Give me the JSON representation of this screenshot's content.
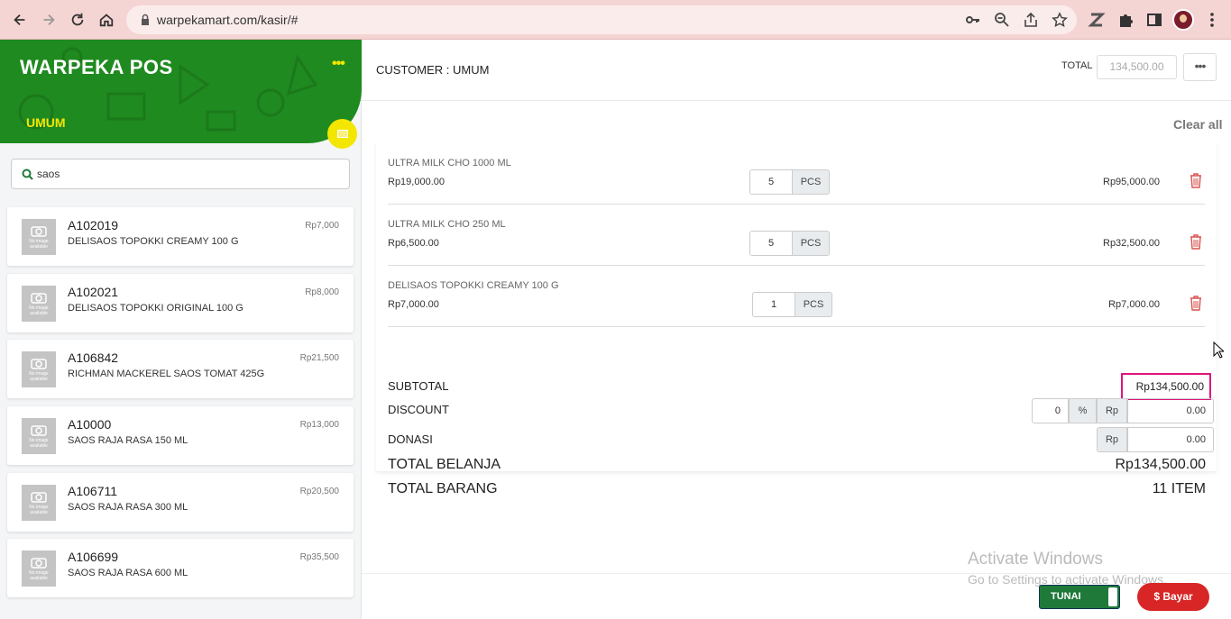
{
  "browser": {
    "url": "warpekamart.com/kasir/#"
  },
  "app": {
    "title": "WARPEKA POS",
    "menu_dots": "•••",
    "customer_tag": "UMUM"
  },
  "search": {
    "value": "saos"
  },
  "products": [
    {
      "code": "A102019",
      "name": "DELISAOS TOPOKKI CREAMY 100 G",
      "price": "Rp7,000"
    },
    {
      "code": "A102021",
      "name": "DELISAOS TOPOKKI ORIGINAL 100 G",
      "price": "Rp8,000"
    },
    {
      "code": "A106842",
      "name": "RICHMAN MACKEREL SAOS TOMAT 425G",
      "price": "Rp21,500"
    },
    {
      "code": "A10000",
      "name": "SAOS RAJA RASA 150 ML",
      "price": "Rp13,000"
    },
    {
      "code": "A106711",
      "name": "SAOS RAJA RASA 300 ML",
      "price": "Rp20,500"
    },
    {
      "code": "A106699",
      "name": "SAOS RAJA RASA 600 ML",
      "price": "Rp35,500"
    }
  ],
  "no_image_text": "No image available",
  "header": {
    "customer": "CUSTOMER : UMUM",
    "total_label": "TOTAL",
    "total_value": "134,500.00",
    "more": "•••"
  },
  "cart": {
    "clear_all": "Clear all",
    "items": [
      {
        "name": "ULTRA MILK CHO 1000 ML",
        "price": "Rp19,000.00",
        "qty": "5",
        "unit": "PCS",
        "total": "Rp95,000.00"
      },
      {
        "name": "ULTRA MILK CHO 250 ML",
        "price": "Rp6,500.00",
        "qty": "5",
        "unit": "PCS",
        "total": "Rp32,500.00"
      },
      {
        "name": "DELISAOS TOPOKKI CREAMY 100 G",
        "price": "Rp7,000.00",
        "qty": "1",
        "unit": "PCS",
        "total": "Rp7,000.00"
      }
    ]
  },
  "summary": {
    "subtotal_label": "SUBTOTAL",
    "subtotal_value": "Rp134,500.00",
    "discount_label": "DISCOUNT",
    "discount_pct": "0",
    "pct_symbol": "%",
    "rp_symbol": "Rp",
    "discount_amount": "0.00",
    "donasi_label": "DONASI",
    "donasi_amount": "0.00",
    "total_belanja_label": "TOTAL BELANJA",
    "total_belanja_value": "Rp134,500.00",
    "total_barang_label": "TOTAL BARANG",
    "total_barang_value": "11 ITEM"
  },
  "footer": {
    "watermark_title": "Activate Windows",
    "watermark_sub": "Go to Settings to activate Windows.",
    "payment_method": "TUNAI",
    "pay_button": "$ Bayar"
  },
  "colors": {
    "brand_green": "#1f8a1f",
    "accent_yellow": "#f3e600",
    "pay_red": "#d82626",
    "highlight_pink": "#e0157b"
  }
}
